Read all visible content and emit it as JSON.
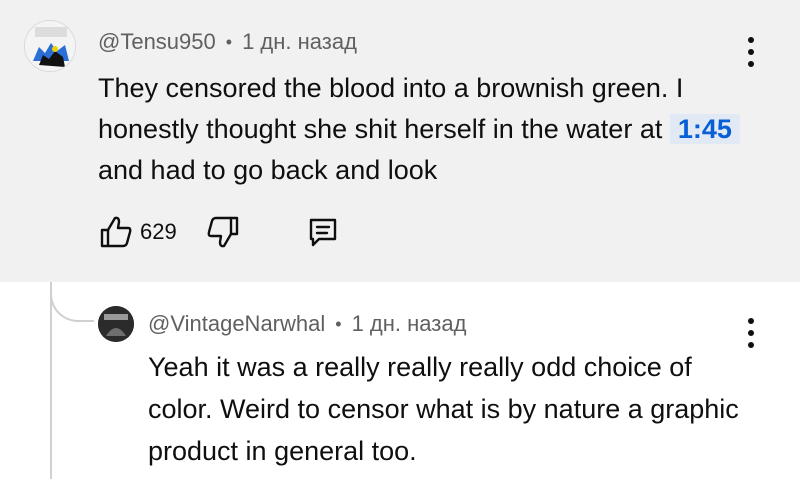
{
  "comment": {
    "author": "@Tensu950",
    "time": "1 дн. назад",
    "text_before": "They censored the blood into a brownish green. I honestly thought she shit herself in the water at ",
    "timestamp": "1:45",
    "text_after": " and had to go back and look",
    "likes": "629",
    "icons": {
      "like": "thumb-up-icon",
      "dislike": "thumb-down-icon",
      "reply": "reply-comment-icon",
      "menu": "more-vertical-icon"
    },
    "colors": {
      "background": "#f1f1f1",
      "timestamp_link": "#065fd4",
      "timestamp_bg": "#e1e9f5",
      "meta": "#606060"
    }
  },
  "reply": {
    "author": "@VintageNarwhal",
    "time": "1 дн. назад",
    "text": "Yeah it was a really really really odd choice of color. Weird to censor what is by nature a graphic product in general too.",
    "icons": {
      "menu": "more-vertical-icon"
    }
  },
  "separator": "•"
}
